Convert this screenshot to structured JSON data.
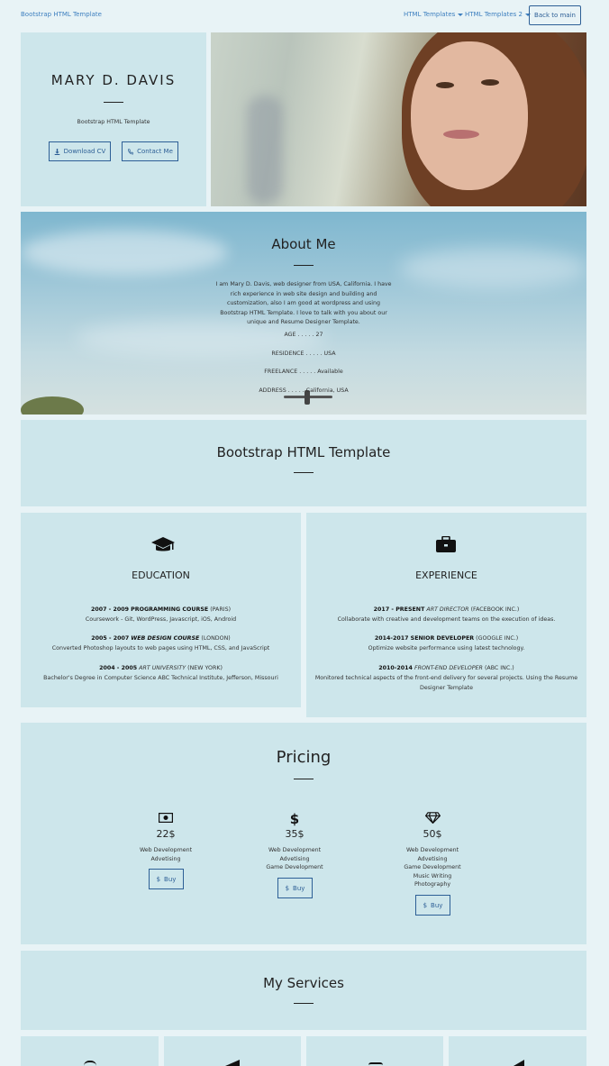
{
  "nav": {
    "brand": "Bootstrap HTML Template",
    "link1": "HTML Templates",
    "link2": "HTML Templates 2",
    "back": "Back to main"
  },
  "hero": {
    "name": "MARY D. DAVIS",
    "subtitle": "Bootstrap HTML Template",
    "download": "Download CV",
    "contact": "Contact Me"
  },
  "about": {
    "title": "About Me",
    "bio": "I am Mary D. Davis, web designer from USA, California. I have rich experience in web site design and building and customization, also I am good at wordpress and using Bootstrap HTML Template. I love to talk with you about our unique and Resume Designer Template.",
    "age": "AGE . . . . . 27",
    "residence": "RESIDENCE . . . . . USA",
    "freelance": "FREELANCE . . . . . Available",
    "address": "ADDRESS . . . . . California, USA"
  },
  "banner": {
    "title": "Bootstrap HTML Template"
  },
  "education": {
    "title": "EDUCATION",
    "items": [
      {
        "date": "2007 - 2009 PROGRAMMING COURSE",
        "place": "(PARIS)",
        "desc": "Coursework - Git, WordPress, Javascript, iOS, Android"
      },
      {
        "date": "2005 - 2007",
        "role": "WEB DESIGN COURSE",
        "place": "(LONDON)",
        "desc": "Converted Photoshop layouts to web pages using HTML, CSS, and JavaScript"
      },
      {
        "date": "2004 - 2005",
        "role": "ART UNIVERSITY",
        "place": "(NEW YORK)",
        "desc": "Bachelor's Degree in Computer Science ABC Technical Institute, Jefferson, Missouri"
      }
    ]
  },
  "experience": {
    "title": "EXPERIENCE",
    "items": [
      {
        "date": "2017 - PRESENT",
        "role": "ART DIRECTOR",
        "place": "(FACEBOOK INC.)",
        "desc": "Collaborate with creative and development teams on the execution of ideas."
      },
      {
        "date": "2014-2017 SENIOR DEVELOPER",
        "place": "(GOOGLE INC.)",
        "desc": "Optimize website performance using latest technology."
      },
      {
        "date": "2010-2014",
        "role": "FRONT-END DEVELOPER",
        "place": "(ABC INC.)",
        "desc1": "Monitored technical aspects of the front-end delivery for several projects. Using the Resume",
        "desc2": "Designer Template"
      }
    ]
  },
  "pricing": {
    "title": "Pricing",
    "plans": [
      {
        "price": "22$",
        "features": [
          "Web Development",
          "Advetising"
        ],
        "buy": "Buy"
      },
      {
        "price": "35$",
        "features": [
          "Web Development",
          "Advetising",
          "Game Development"
        ],
        "buy": "Buy"
      },
      {
        "price": "50$",
        "features": [
          "Web Development",
          "Advetising",
          "Game Development",
          "Music Writing",
          "Photography"
        ],
        "buy": "Buy"
      }
    ]
  },
  "services": {
    "title": "My Services"
  },
  "colors": {
    "accent": "#2d5f96",
    "panel": "#cde6eb",
    "background": "#e8f3f6"
  }
}
